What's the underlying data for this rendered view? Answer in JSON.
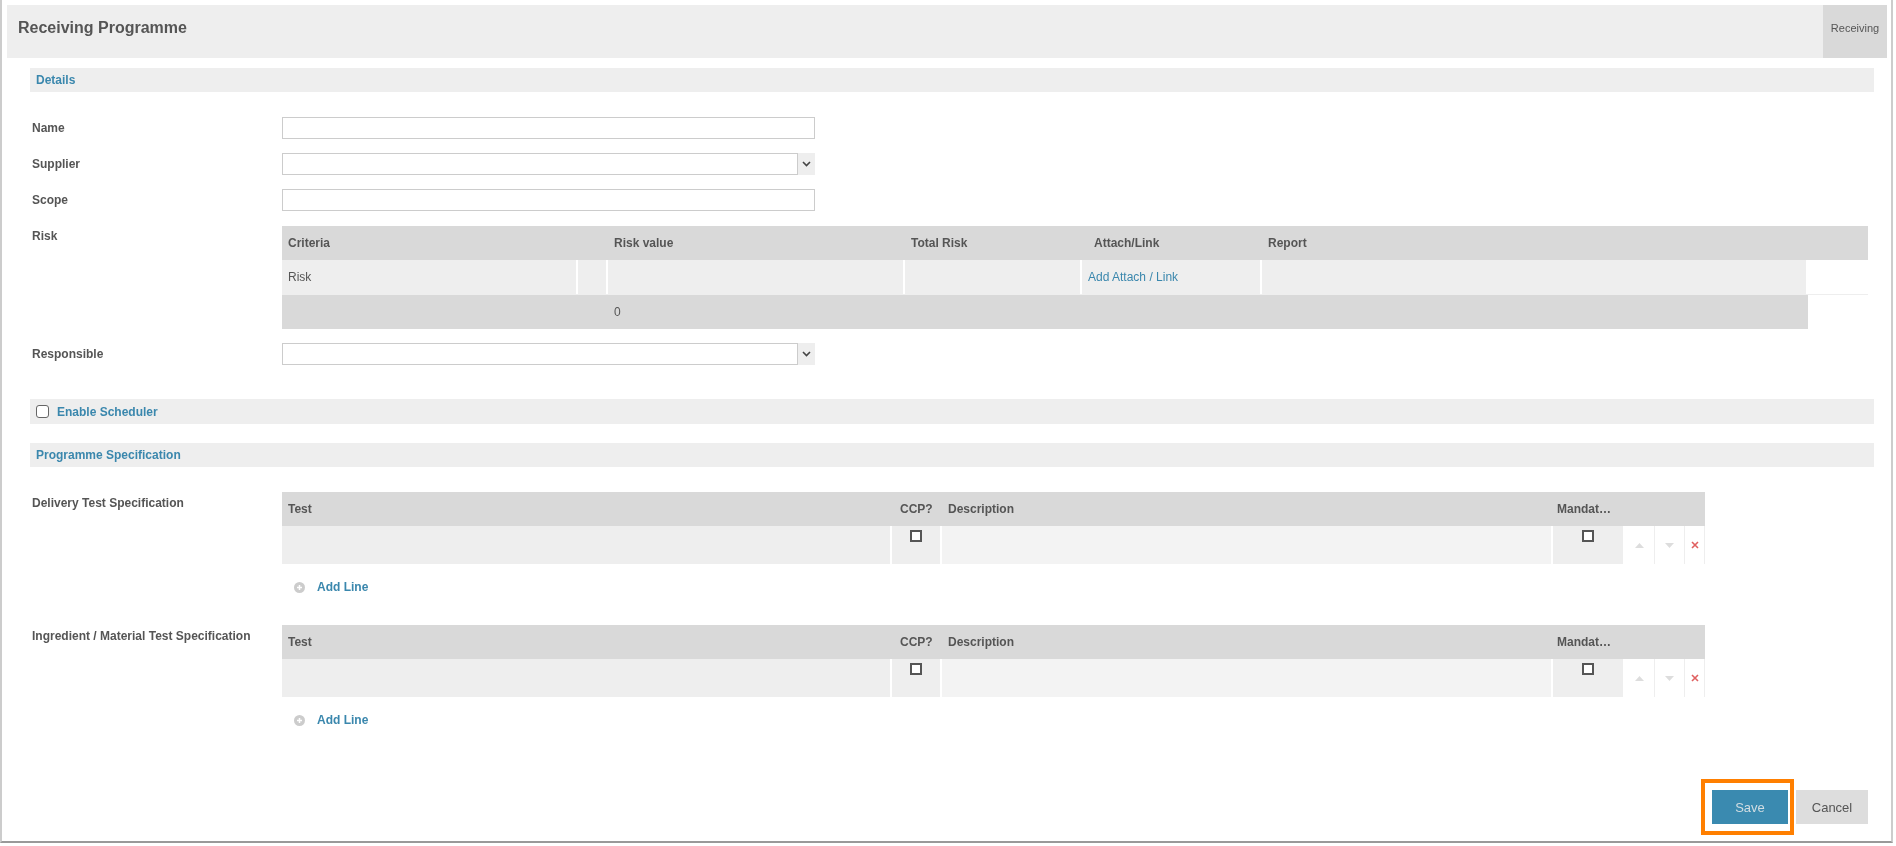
{
  "header": {
    "title": "Receiving Programme",
    "tab": "Receiving"
  },
  "details": {
    "title": "Details",
    "fields": [
      {
        "label": "Name",
        "kind": "text"
      },
      {
        "label": "Supplier",
        "kind": "select"
      },
      {
        "label": "Scope",
        "kind": "text"
      },
      {
        "label": "Risk",
        "kind": "risk",
        "columns": [
          "Criteria",
          "",
          "Risk value",
          "Total Risk",
          "Attach/Link",
          "Report"
        ],
        "row": {
          "criteria": "Risk",
          "link": "Add Attach / Link"
        },
        "total": "0"
      },
      {
        "label": "Responsible",
        "kind": "select"
      }
    ]
  },
  "scheduler": {
    "label": "Enable Scheduler",
    "checked": false
  },
  "specification": {
    "title": "Programme Specification",
    "tables": [
      {
        "label": "Delivery Test Specification",
        "columns": [
          "Test",
          "CCP?",
          "Description",
          "Mandat…"
        ],
        "rows": [
          {
            "ccp": false,
            "mandatory": false
          }
        ],
        "add_label": "Add Line"
      },
      {
        "label": "Ingredient / Material Test Specification",
        "columns": [
          "Test",
          "CCP?",
          "Description",
          "Mandat…"
        ],
        "rows": [
          {
            "ccp": false,
            "mandatory": false
          }
        ],
        "add_label": "Add Line"
      }
    ]
  },
  "buttons": [
    {
      "label": "Save",
      "kind": "primary",
      "disabled": true,
      "highlighted": true
    },
    {
      "label": "Cancel",
      "kind": "secondary",
      "disabled": false,
      "highlighted": false
    }
  ]
}
